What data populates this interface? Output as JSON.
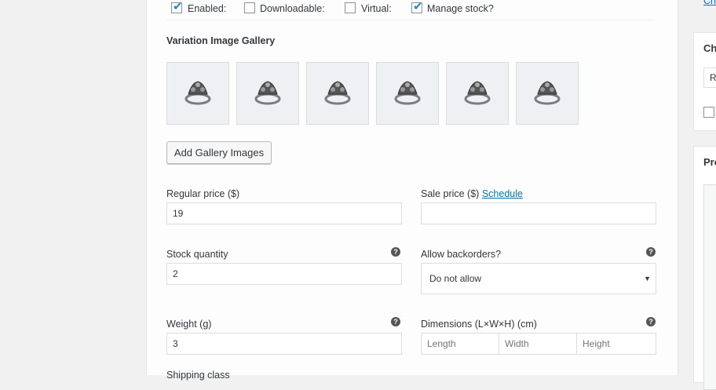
{
  "options": {
    "enabled": {
      "label": "Enabled:",
      "checked": true
    },
    "downloadable": {
      "label": "Downloadable:",
      "checked": false
    },
    "virtual": {
      "label": "Virtual:",
      "checked": false
    },
    "manage_stock": {
      "label": "Manage stock?",
      "checked": true
    }
  },
  "gallery": {
    "title": "Variation Image Gallery",
    "images": [
      "ring-icon",
      "ring-icon",
      "ring-icon",
      "ring-icon",
      "ring-icon",
      "ring-icon"
    ],
    "add_button": "Add Gallery Images"
  },
  "regular_price": {
    "label": "Regular price ($)",
    "value": "19"
  },
  "sale_price": {
    "label": "Sale price ($)",
    "schedule_link": "Schedule",
    "value": ""
  },
  "stock_quantity": {
    "label": "Stock quantity",
    "value": "2"
  },
  "backorders": {
    "label": "Allow backorders?",
    "selected": "Do not allow"
  },
  "weight": {
    "label": "Weight (g)",
    "value": "3"
  },
  "dimensions": {
    "label": "Dimensions (L×W×H) (cm)",
    "length_placeholder": "Length",
    "width_placeholder": "Width",
    "height_placeholder": "Height"
  },
  "shipping_class": {
    "label": "Shipping class"
  },
  "sidebar": {
    "top_link": "Ch",
    "box1_title": "Ch",
    "box1_field": "R",
    "box2_title": "Pro"
  },
  "colors": {
    "link": "#0073aa",
    "check": "#1e8cbe"
  }
}
